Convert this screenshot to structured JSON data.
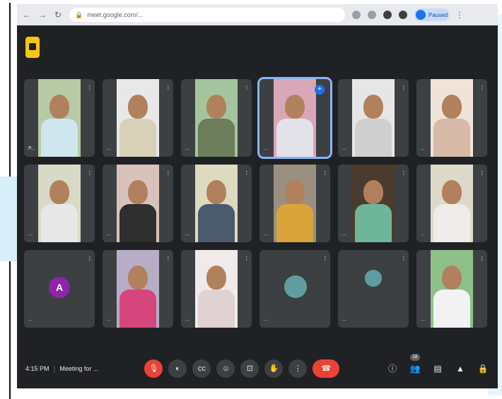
{
  "browser": {
    "url": "meet.google.com/...",
    "back_icon": "back-arrow-icon",
    "profile_label": "Paused"
  },
  "tiles": [
    {
      "name": "P...",
      "shirt": "#cfe6ef",
      "bg": "#b8c9a6"
    },
    {
      "name": "...",
      "shirt": "#d9d0b8",
      "bg": "#e8e8e8"
    },
    {
      "name": "...",
      "shirt": "#6b7d5a",
      "bg": "#a5c4a0"
    },
    {
      "name": "...",
      "shirt": "#e3e2e8",
      "bg": "#d8a8b8"
    },
    {
      "name": "...",
      "shirt": "#cfcfcf",
      "bg": "#e6e6e6"
    },
    {
      "name": "...",
      "shirt": "#d6b9a6",
      "bg": "#efe3da"
    },
    {
      "name": "...",
      "shirt": "#e8e8e8",
      "bg": "#d8dac6"
    },
    {
      "name": "...",
      "shirt": "#2f2f2f",
      "bg": "#d9c2bb"
    },
    {
      "name": "...",
      "shirt": "#4c5a6e",
      "bg": "#dedac0"
    },
    {
      "name": "...",
      "shirt": "#d9a53a",
      "bg": "#9a8f80"
    },
    {
      "name": "...",
      "shirt": "#6fb59a",
      "bg": "#4a3b2e"
    },
    {
      "name": "...",
      "shirt": "#f0ecea",
      "bg": "#ddd8c8"
    },
    {
      "name": "...",
      "avatar": "A",
      "avatar_color": "#8e24aa"
    },
    {
      "name": "...",
      "shirt": "#d6457c",
      "bg": "#b7adc6"
    },
    {
      "name": "...",
      "shirt": "#e0d2d2",
      "bg": "#f0eaea"
    },
    {
      "name": "...",
      "avatar_img": true
    },
    {
      "name": "...",
      "avatar_img": true,
      "small": true
    },
    {
      "name": "...",
      "shirt": "#f2f2f2",
      "bg": "#8fc08a"
    }
  ],
  "bottom": {
    "time": "4:15 PM",
    "title": "Meeting for ...",
    "raise_count": "18"
  },
  "colors": {
    "meet_bg": "#202124",
    "tile_bg": "#3c4043",
    "danger": "#ea4335",
    "logo": "#f9c513"
  }
}
